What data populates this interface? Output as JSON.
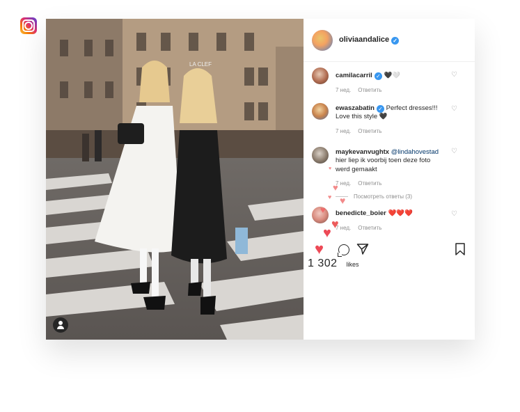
{
  "post": {
    "username": "oliviaandalice",
    "verified_mark": "✓",
    "storefront_sign": "LA CLEF"
  },
  "comments": [
    {
      "user": "camilacarril",
      "text": "🖤🤍",
      "time": "7 нед.",
      "reply": "Ответить"
    },
    {
      "user": "ewaszabatin",
      "text": "Perfect dresses!!! Love this style 🖤",
      "time": "7 нед.",
      "reply": "Ответить"
    },
    {
      "user": "maykevanvughtx",
      "mention": "@lindahovestad",
      "text": "hier liep ik voorbij toen deze foto werd gemaakt",
      "time": "7 нед.",
      "reply": "Ответить",
      "view_replies": "Посмотреть ответы (3)"
    },
    {
      "user": "benedicte_boier",
      "text": "❤️❤️❤️",
      "time": "7 нед.",
      "reply": "Ответить"
    }
  ],
  "actions": {
    "like_icon": "heart-filled-icon",
    "comment_icon": "comment-icon",
    "share_icon": "paper-plane-icon",
    "save_icon": "bookmark-icon",
    "likes_count": "1 302",
    "likes_label": "likes"
  },
  "colors": {
    "like_red": "#ed4956",
    "verified_blue": "#3897f0",
    "floating_heart": "#f28a8a"
  }
}
